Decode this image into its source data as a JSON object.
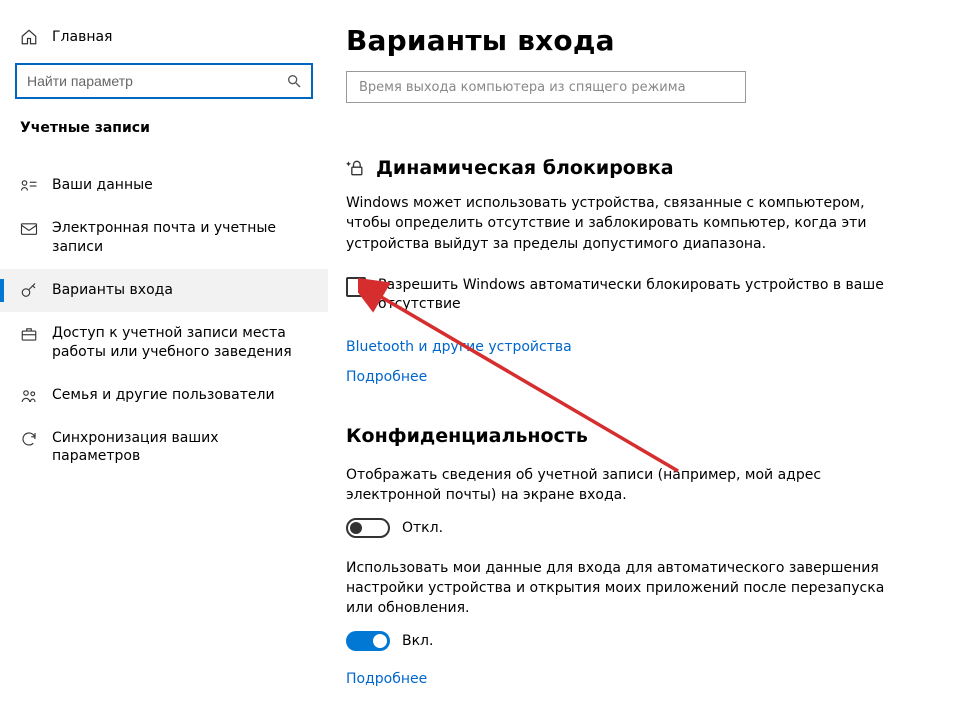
{
  "home_label": "Главная",
  "search": {
    "placeholder": "Найти параметр"
  },
  "section_title": "Учетные записи",
  "nav": [
    {
      "label": "Ваши данные"
    },
    {
      "label": "Электронная почта и учетные записи"
    },
    {
      "label": "Варианты входа"
    },
    {
      "label": "Доступ к учетной записи места работы или учебного заведения"
    },
    {
      "label": "Семья и другие пользователи"
    },
    {
      "label": "Синхронизация ваших параметров"
    }
  ],
  "page_title": "Варианты входа",
  "dropdown_stub": "Время выхода компьютера из спящего режима",
  "dynamic_lock": {
    "heading": "Динамическая блокировка",
    "description": "Windows может использовать устройства, связанные с компьютером, чтобы определить отсутствие и заблокировать компьютер, когда эти устройства выйдут за пределы допустимого диапазона.",
    "checkbox_label": "Разрешить Windows автоматически блокировать устройство в ваше отсутствие",
    "link_bluetooth": "Bluetooth и другие устройства",
    "link_more": "Подробнее"
  },
  "privacy": {
    "heading": "Конфиденциальность",
    "text1": "Отображать сведения об учетной записи (например, мой адрес электронной почты) на экране входа.",
    "toggle1_label": "Откл.",
    "text2": "Использовать мои данные для входа для автоматического завершения настройки устройства и открытия моих приложений после перезапуска или обновления.",
    "toggle2_label": "Вкл.",
    "link_more": "Подробнее"
  }
}
